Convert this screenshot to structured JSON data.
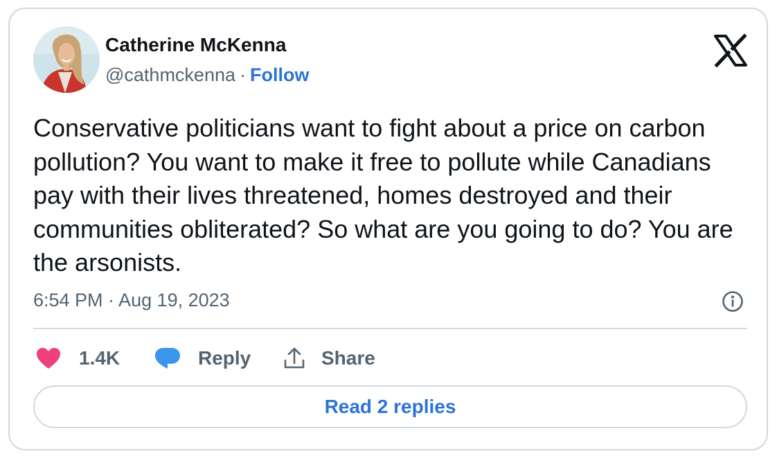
{
  "author": {
    "name": "Catherine McKenna",
    "handle": "@cathmckenna",
    "separator": "·",
    "follow_label": "Follow"
  },
  "tweet": {
    "text": "Conservative politicians want to fight about a price on carbon pollution? You want to make it free to pollute while Canadians pay with their lives threatened, homes destroyed and their communities obliterated? So what are you going to do? You are the arsonists.",
    "timestamp": "6:54 PM · Aug 19, 2023"
  },
  "actions": {
    "like_count": "1.4K",
    "reply_label": "Reply",
    "share_label": "Share"
  },
  "read_replies_label": "Read 2 replies",
  "icons": {
    "brand": "x-logo-icon",
    "info": "info-icon",
    "like": "heart-icon",
    "reply": "speech-bubble-icon",
    "share": "share-upload-icon"
  },
  "colors": {
    "text_primary": "#0f1419",
    "text_secondary": "#536471",
    "link_blue": "#2b74d6",
    "like_pink": "#f0407a",
    "reply_blue": "#3e95ec",
    "border": "#cfd9de"
  }
}
